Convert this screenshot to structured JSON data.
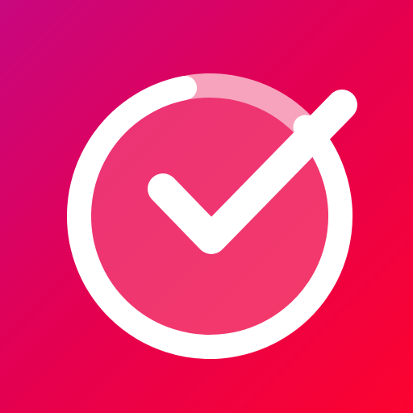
{
  "icon": {
    "name": "checkmark-progress-icon",
    "background_gradient": [
      "#c8077f",
      "#e5004f",
      "#fc0330"
    ],
    "inner_disc_gradient": [
      "#eb3276",
      "#f43a69"
    ],
    "ring_color": "#ffffff",
    "ring_remaining_color": "#f7a3bd",
    "checkmark_color": "#ffffff",
    "progress_fraction": 0.85
  }
}
